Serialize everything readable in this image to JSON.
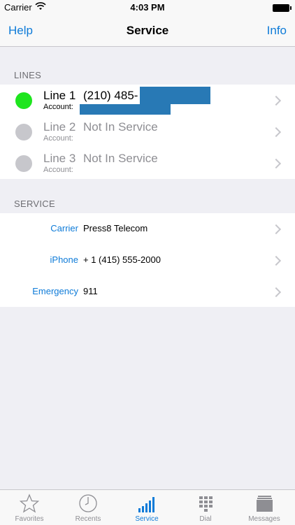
{
  "status_bar": {
    "carrier": "Carrier",
    "time": "4:03 PM"
  },
  "nav": {
    "left": "Help",
    "title": "Service",
    "right": "Info"
  },
  "lines_section": {
    "header": "LINES",
    "lines": [
      {
        "name": "Line 1",
        "number": "(210) 485-",
        "account_label": "Account:",
        "status_color": "#1ee51e"
      },
      {
        "name": "Line 2",
        "number": "Not In Service",
        "account_label": "Account:",
        "status_color": "#c7c7cc"
      },
      {
        "name": "Line 3",
        "number": "Not In Service",
        "account_label": "Account:",
        "status_color": "#c7c7cc"
      }
    ]
  },
  "service_section": {
    "header": "SERVICE",
    "rows": [
      {
        "label": "Carrier",
        "value": "Press8 Telecom"
      },
      {
        "label": "iPhone",
        "value": "+ 1 (415) 555-2000"
      },
      {
        "label": "Emergency",
        "value": "911"
      }
    ]
  },
  "tabs": [
    {
      "label": "Favorites",
      "icon": "star-icon"
    },
    {
      "label": "Recents",
      "icon": "clock-icon"
    },
    {
      "label": "Service",
      "icon": "signal-bars-icon"
    },
    {
      "label": "Dial",
      "icon": "keypad-icon"
    },
    {
      "label": "Messages",
      "icon": "messages-icon"
    }
  ],
  "colors": {
    "accent": "#0e7bd8",
    "active_line": "#1ee51e",
    "redaction": "#2879b5"
  }
}
